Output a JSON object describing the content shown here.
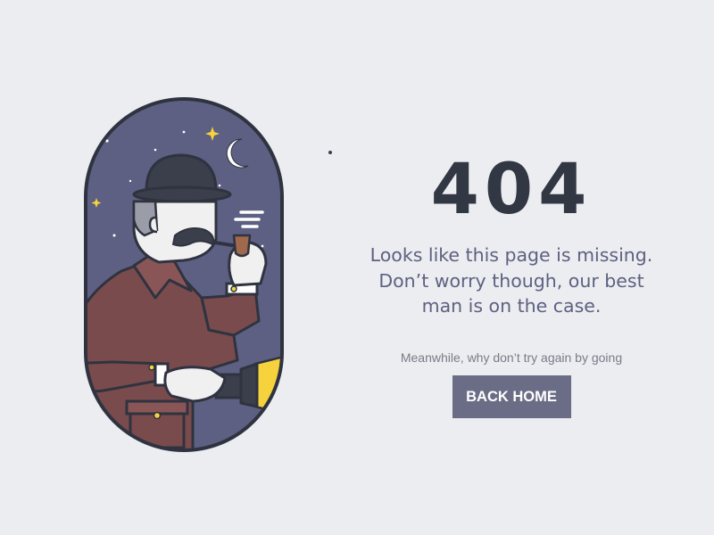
{
  "error": {
    "code": "404",
    "message_lines": [
      "Looks like this page is missing.",
      "Don’t worry though, our best",
      "man is on the case."
    ],
    "subtext": "Meanwhile, why don’t try again by going",
    "button_label": "BACK HOME"
  },
  "illustration": {
    "subject": "detective-with-pipe-and-flashlight",
    "colors": {
      "night_sky": "#5d6082",
      "outline": "#2f3340",
      "coat": "#7a4b4c",
      "hat": "#3b3f4c",
      "skin": "#f0f0f0",
      "beam": "#f6d33c",
      "moon": "#ffffff"
    }
  },
  "theme": {
    "background": "#ebedf0",
    "heading_color": "#323744",
    "text_color": "#5e6180",
    "button_color": "#6b6d86"
  }
}
